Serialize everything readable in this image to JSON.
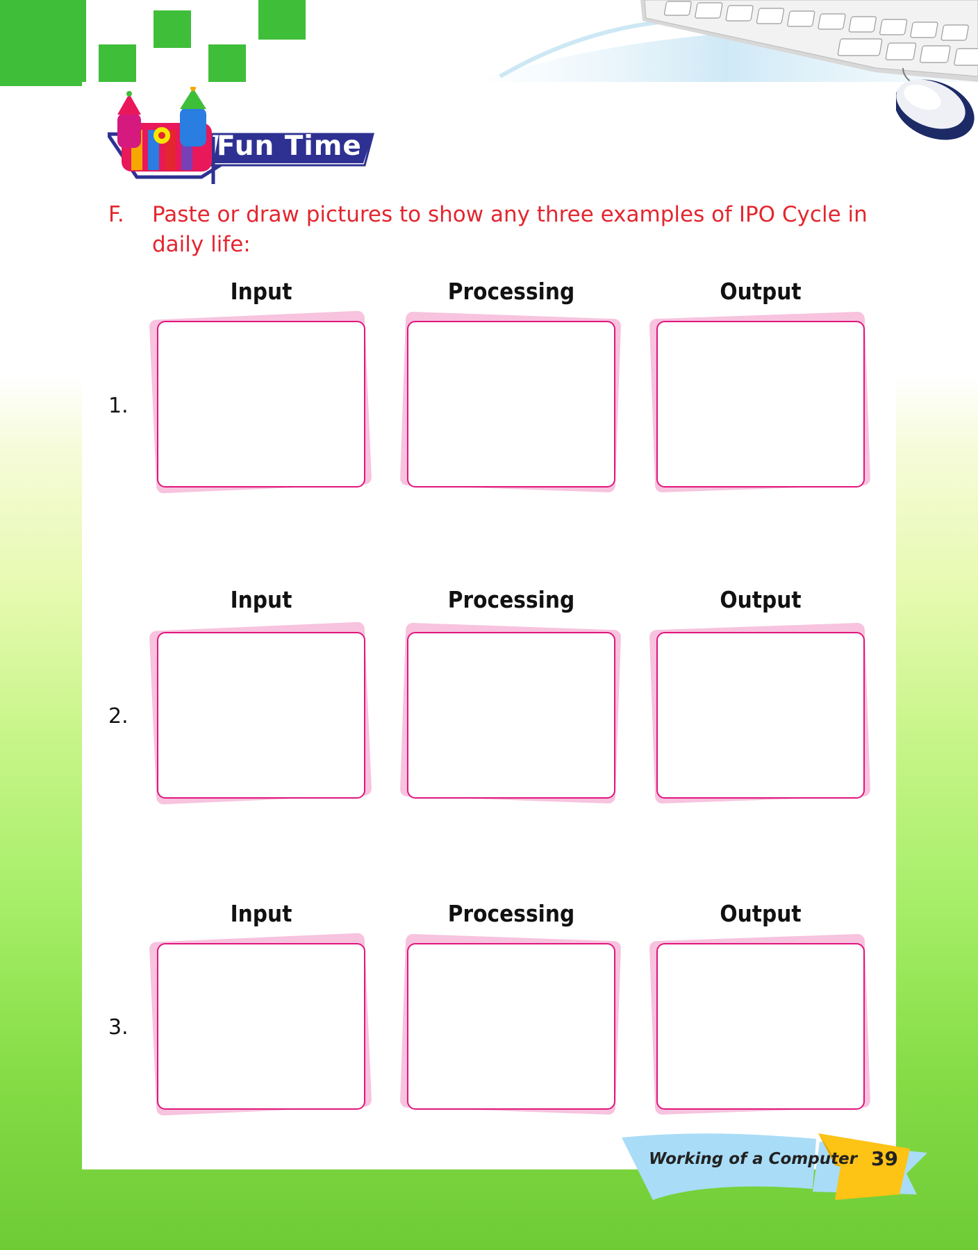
{
  "heading": {
    "title": "Fun Time"
  },
  "question": {
    "letter": "F.",
    "text": "Paste or draw pictures to show any three examples of IPO Cycle in daily life:"
  },
  "rows": [
    {
      "number": "1.",
      "labels": [
        "Input",
        "Processing",
        "Output"
      ]
    },
    {
      "number": "2.",
      "labels": [
        "Input",
        "Processing",
        "Output"
      ]
    },
    {
      "number": "3.",
      "labels": [
        "Input",
        "Processing",
        "Output"
      ]
    }
  ],
  "footer": {
    "chapter": "Working of a Computer",
    "page": "39"
  },
  "colors": {
    "green": "#3fbe3a",
    "red_text": "#e3262f",
    "pink_border": "#e0157d",
    "navy": "#2e3192"
  }
}
